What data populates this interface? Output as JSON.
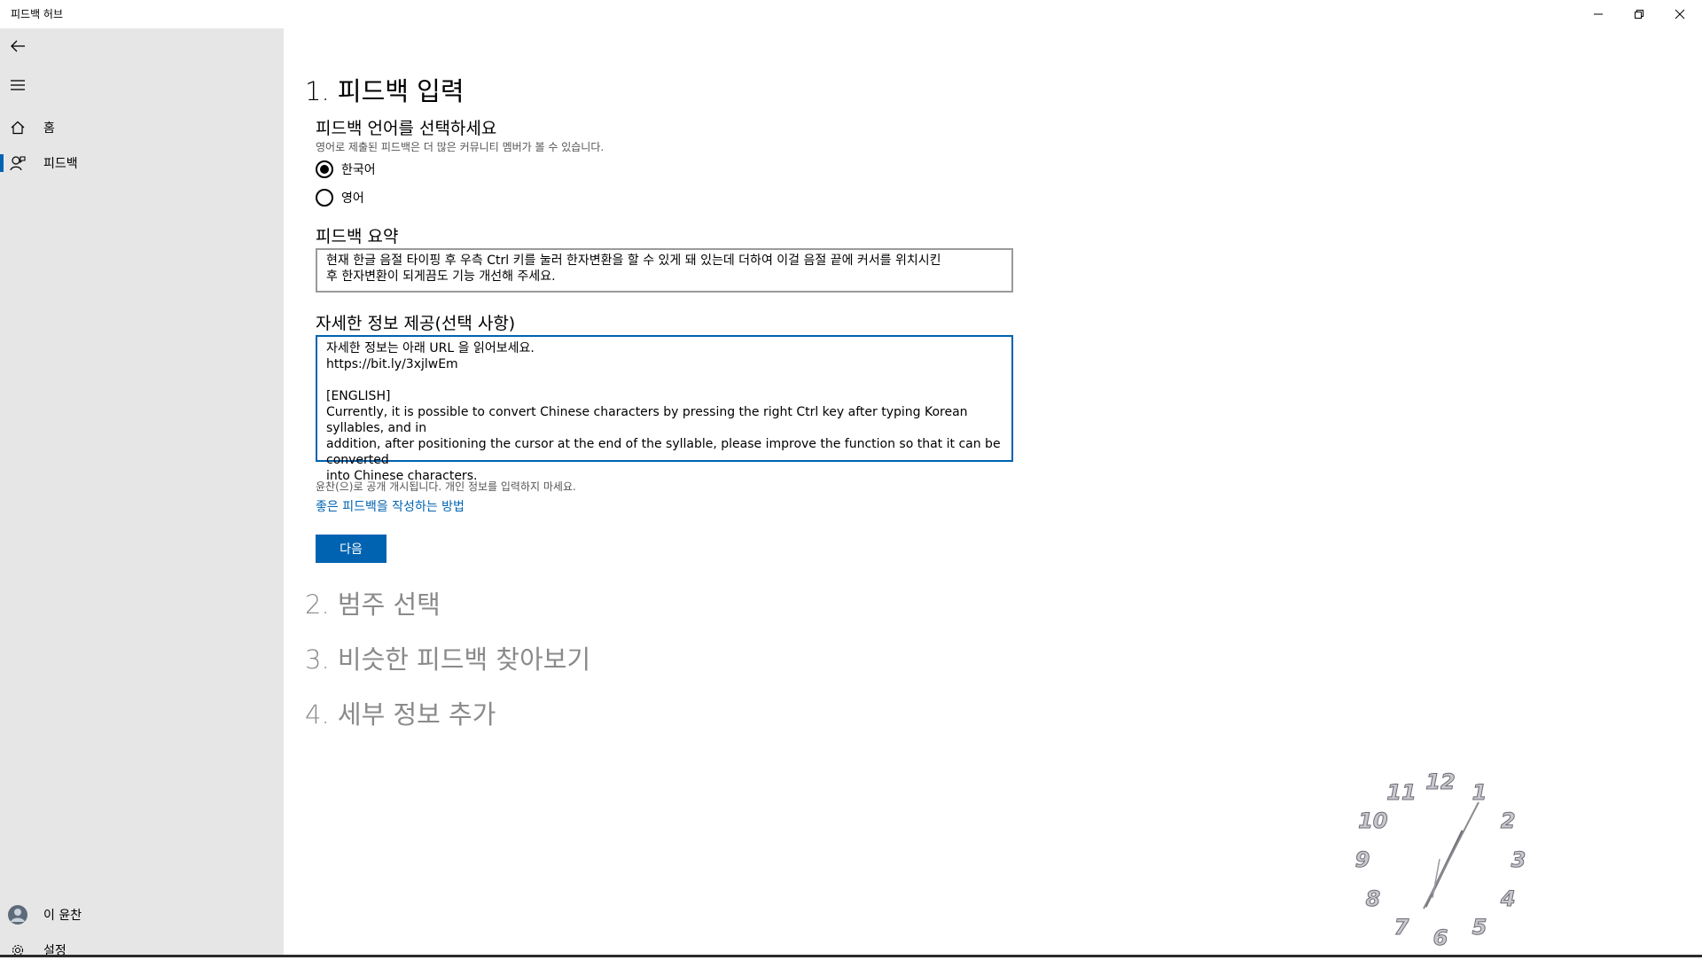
{
  "app": {
    "title": "피드백 허브"
  },
  "sidebar": {
    "items": [
      {
        "label": "홈",
        "icon": "home-icon"
      },
      {
        "label": "피드백",
        "icon": "feedback-icon"
      }
    ],
    "user": {
      "name": "이 윤찬"
    },
    "settings_label": "설정",
    "accent": "#0063b1"
  },
  "steps": [
    {
      "label": "1. 피드백 입력"
    },
    {
      "label": "2. 범주 선택"
    },
    {
      "label": "3. 비슷한 피드백 찾아보기"
    },
    {
      "label": "4. 세부 정보 추가"
    }
  ],
  "form": {
    "language_title": "피드백 언어를 선택하세요",
    "language_hint": "영어로 제출된 피드백은 더 많은 커뮤니티 멤버가 볼 수 있습니다.",
    "options": [
      {
        "label": "한국어",
        "selected": true
      },
      {
        "label": "영어",
        "selected": false
      }
    ],
    "summary_title": "피드백 요약",
    "summary_value": "현재 한글 음절 타이핑 후 우측 Ctrl 키를 눌러 한자변환을 할 수 있게 돼 있는데 더하여 이걸 음절 끝에 커서를 위치시킨\n후 한자변환이 되게끔도 기능 개선해 주세요.",
    "details_title": "자세한 정보 제공(선택 사항)",
    "details_value": "자세한 정보는 아래 URL 을 읽어보세요.\nhttps://bit.ly/3xjlwEm\n\n[ENGLISH]\nCurrently, it is possible to convert Chinese characters by pressing the right Ctrl key after typing Korean syllables, and in\naddition, after positioning the cursor at the end of the syllable, please improve the function so that it can be converted\ninto Chinese characters.",
    "public_note": "윤찬(으)로 공개 개시됩니다. 개인 정보를 입력하지 마세요.",
    "guide_link": "좋은 피드백을 작성하는 방법",
    "next_button": "다음"
  },
  "clock": {
    "numbers": [
      "12",
      "1",
      "2",
      "3",
      "4",
      "5",
      "6",
      "7",
      "8",
      "9",
      "10",
      "11"
    ]
  }
}
